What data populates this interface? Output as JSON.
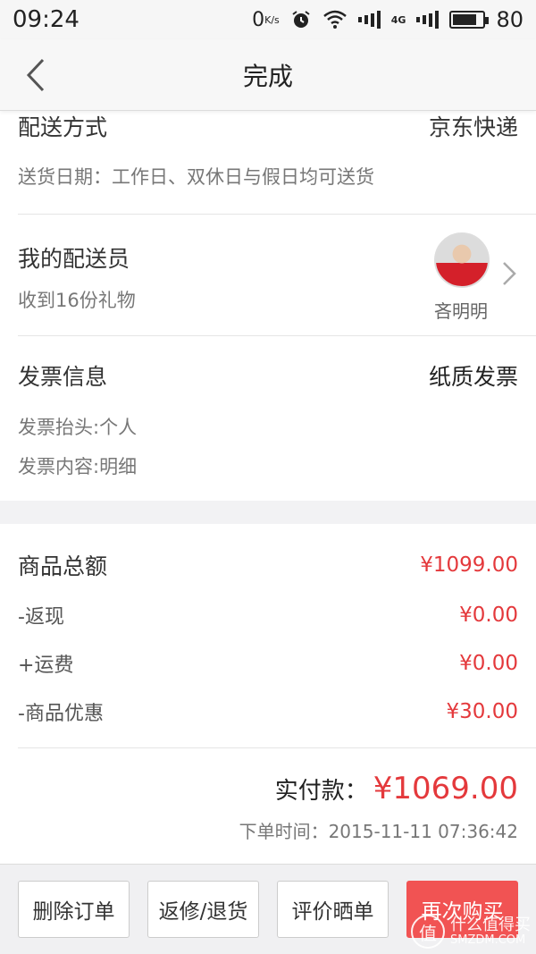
{
  "status_bar": {
    "time": "09:24",
    "net_speed": "0",
    "net_unit": "K/s",
    "network": "4G",
    "battery": "80",
    "battery_level": 0.8
  },
  "nav": {
    "title": "完成",
    "back_icon": "chevron-left-icon"
  },
  "delivery": {
    "method_label": "配送方式",
    "method_value": "京东快递",
    "date_text": "送货日期：工作日、双休日与假日均可送货"
  },
  "courier": {
    "title": "我的配送员",
    "gifts": "收到16份礼物",
    "name": "吝明明"
  },
  "invoice": {
    "title": "发票信息",
    "type": "纸质发票",
    "header": "发票抬头:个人",
    "content": "发票内容:明细"
  },
  "amounts": {
    "rows": [
      {
        "label": "商品总额",
        "value": "¥1099.00"
      },
      {
        "label": "-返现",
        "value": "¥0.00"
      },
      {
        "label": "+运费",
        "value": "¥0.00"
      },
      {
        "label": "-商品优惠",
        "value": "¥30.00"
      }
    ],
    "paid_label": "实付款：",
    "paid_value": "¥1069.00",
    "order_time": "下单时间：2015-11-11 07:36:42"
  },
  "actions": {
    "delete": "删除订单",
    "return": "返修/退货",
    "review": "评价晒单",
    "rebuy": "再次购买"
  },
  "watermark": {
    "icon_char": "值",
    "line1": "什么值得买",
    "line2": "SMZDM.COM"
  },
  "colors": {
    "accent": "#e4393c",
    "primary_button": "#f15353"
  }
}
